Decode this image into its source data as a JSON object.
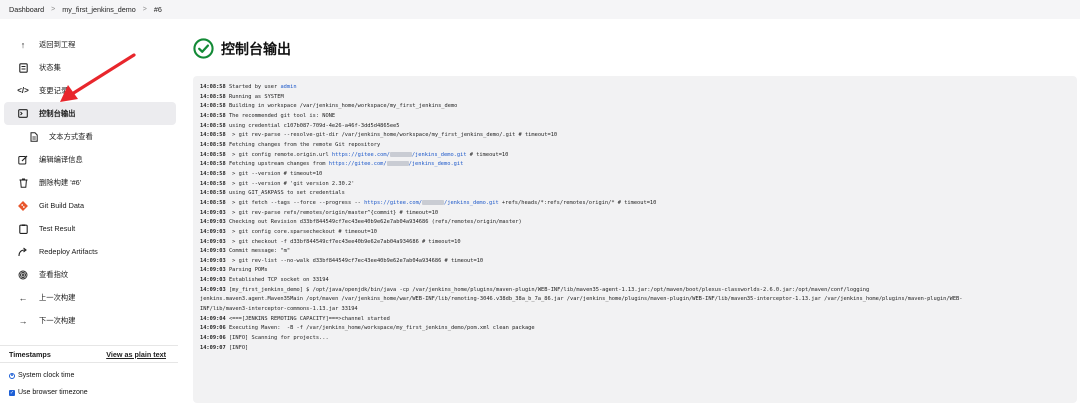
{
  "breadcrumb": [
    "Dashboard",
    "my_first_jenkins_demo",
    "#6"
  ],
  "sidebar": {
    "items": [
      {
        "name": "back-to-project",
        "icon": "arrow-up-icon",
        "label": "返回到工程"
      },
      {
        "name": "status",
        "icon": "document-icon",
        "label": "状态集"
      },
      {
        "name": "changes",
        "icon": "code-icon",
        "label": "变更记录"
      },
      {
        "name": "console-output",
        "icon": "terminal-icon",
        "label": "控制台输出",
        "active": true
      },
      {
        "name": "plain-text",
        "icon": "file-icon",
        "label": "文本方式查看",
        "sub": true
      },
      {
        "name": "edit-build-info",
        "icon": "edit-icon",
        "label": "编辑编译信息"
      },
      {
        "name": "delete-build",
        "icon": "trash-icon",
        "label": "删除构建 '#6'"
      },
      {
        "name": "git-build-data",
        "icon": "git-icon",
        "label": "Git Build Data"
      },
      {
        "name": "test-result",
        "icon": "clipboard-icon",
        "label": "Test Result"
      },
      {
        "name": "redeploy-artifacts",
        "icon": "redeploy-icon",
        "label": "Redeploy Artifacts"
      },
      {
        "name": "fingerprints",
        "icon": "fingerprint-icon",
        "label": "查看指纹"
      },
      {
        "name": "previous-build",
        "icon": "arrow-left-icon",
        "label": "上一次构建"
      },
      {
        "name": "next-build",
        "icon": "arrow-right-icon",
        "label": "下一次构建"
      }
    ]
  },
  "timestamps": {
    "title": "Timestamps",
    "link": "View as plain text",
    "option_system": "System clock time",
    "option_browser": "Use browser timezone"
  },
  "page_title": "控制台输出",
  "console": [
    {
      "t": "14:08:58",
      "parts": [
        [
          "Started by user ",
          ""
        ],
        [
          "admin",
          "link"
        ]
      ]
    },
    {
      "t": "14:08:58",
      "parts": [
        [
          "Running as SYSTEM",
          ""
        ]
      ]
    },
    {
      "t": "14:08:58",
      "parts": [
        [
          "Building in workspace /var/jenkins_home/workspace/my_first_jenkins_demo",
          ""
        ]
      ]
    },
    {
      "t": "14:08:58",
      "parts": [
        [
          "The recommended git tool is: NONE",
          ""
        ]
      ]
    },
    {
      "t": "14:08:58",
      "parts": [
        [
          "using credential c107b087-709d-4e26-a46f-3dd5d4865ee5",
          ""
        ]
      ]
    },
    {
      "t": "14:08:58",
      "parts": [
        [
          " > git rev-parse --resolve-git-dir /var/jenkins_home/workspace/my_first_jenkins_demo/.git # timeout=10",
          ""
        ]
      ]
    },
    {
      "t": "14:08:58",
      "parts": [
        [
          "Fetching changes from the remote Git repository",
          ""
        ]
      ]
    },
    {
      "t": "14:08:58",
      "parts": [
        [
          " > git config remote.origin.url ",
          ""
        ],
        [
          "https://gitee.com/",
          "link"
        ],
        [
          "",
          "blur"
        ],
        [
          "/jenkins_demo.git",
          "link"
        ],
        [
          " # timeout=10",
          ""
        ]
      ]
    },
    {
      "t": "14:08:58",
      "parts": [
        [
          "Fetching upstream changes from ",
          ""
        ],
        [
          "https://gitee.com/",
          "link"
        ],
        [
          "",
          "blur"
        ],
        [
          "/jenkins_demo.git",
          "link"
        ]
      ]
    },
    {
      "t": "14:08:58",
      "parts": [
        [
          " > git --version # timeout=10",
          ""
        ]
      ]
    },
    {
      "t": "14:08:58",
      "parts": [
        [
          " > git --version # 'git version 2.30.2'",
          ""
        ]
      ]
    },
    {
      "t": "14:08:58",
      "parts": [
        [
          "using GIT_ASKPASS to set credentials",
          ""
        ]
      ]
    },
    {
      "t": "14:08:58",
      "parts": [
        [
          " > git fetch --tags --force --progress -- ",
          ""
        ],
        [
          "https://gitee.com/",
          "link"
        ],
        [
          "",
          "blur"
        ],
        [
          "/jenkins_demo.git",
          "link"
        ],
        [
          " +refs/heads/*:refs/remotes/origin/* # timeout=10",
          ""
        ]
      ]
    },
    {
      "t": "14:09:03",
      "parts": [
        [
          " > git rev-parse refs/remotes/origin/master^{commit} # timeout=10",
          ""
        ]
      ]
    },
    {
      "t": "14:09:03",
      "parts": [
        [
          "Checking out Revision d33bf844549cf7ec43ee40b9e62e7ab04a934686 (refs/remotes/origin/master)",
          ""
        ]
      ]
    },
    {
      "t": "14:09:03",
      "parts": [
        [
          " > git config core.sparsecheckout # timeout=10",
          ""
        ]
      ]
    },
    {
      "t": "14:09:03",
      "parts": [
        [
          " > git checkout -f d33bf844549cf7ec43ee40b9e62e7ab04a934686 # timeout=10",
          ""
        ]
      ]
    },
    {
      "t": "14:09:03",
      "parts": [
        [
          "Commit message: \"m\"",
          ""
        ]
      ]
    },
    {
      "t": "14:09:03",
      "parts": [
        [
          " > git rev-list --no-walk d33bf844549cf7ec43ee40b9e62e7ab04a934686 # timeout=10",
          ""
        ]
      ]
    },
    {
      "t": "14:09:03",
      "parts": [
        [
          "Parsing POMs",
          ""
        ]
      ]
    },
    {
      "t": "14:09:03",
      "parts": [
        [
          "Established TCP socket on 33194",
          ""
        ]
      ]
    },
    {
      "t": "14:09:03",
      "parts": [
        [
          "[my_first_jenkins_demo] $ /opt/java/openjdk/bin/java -cp /var/jenkins_home/plugins/maven-plugin/WEB-INF/lib/maven35-agent-1.13.jar:/opt/maven/boot/plexus-classworlds-2.6.0.jar:/opt/maven/conf/logging",
          ""
        ]
      ]
    },
    {
      "t": "",
      "parts": [
        [
          "jenkins.maven3.agent.Maven35Main /opt/maven /var/jenkins_home/war/WEB-INF/lib/remoting-3046.v38db_38a_b_7a_86.jar /var/jenkins_home/plugins/maven-plugin/WEB-INF/lib/maven35-interceptor-1.13.jar /var/jenkins_home/plugins/maven-plugin/WEB-",
          ""
        ]
      ]
    },
    {
      "t": "",
      "parts": [
        [
          "INF/lib/maven3-interceptor-commons-1.13.jar 33194",
          ""
        ]
      ]
    },
    {
      "t": "14:09:04",
      "parts": [
        [
          "<===[JENKINS REMOTING CAPACITY]===>channel started",
          ""
        ]
      ]
    },
    {
      "t": "14:09:06",
      "parts": [
        [
          "Executing Maven:  -B -f /var/jenkins_home/workspace/my_first_jenkins_demo/pom.xml clean package",
          ""
        ]
      ]
    },
    {
      "t": "14:09:06",
      "parts": [
        [
          "[INFO] Scanning for projects...",
          ""
        ]
      ]
    },
    {
      "t": "14:09:07",
      "parts": [
        [
          "[INFO]",
          ""
        ]
      ]
    }
  ],
  "colors": {
    "accent": "#1d5fd6",
    "success": "#138a36",
    "arrow": "#e8262c"
  }
}
